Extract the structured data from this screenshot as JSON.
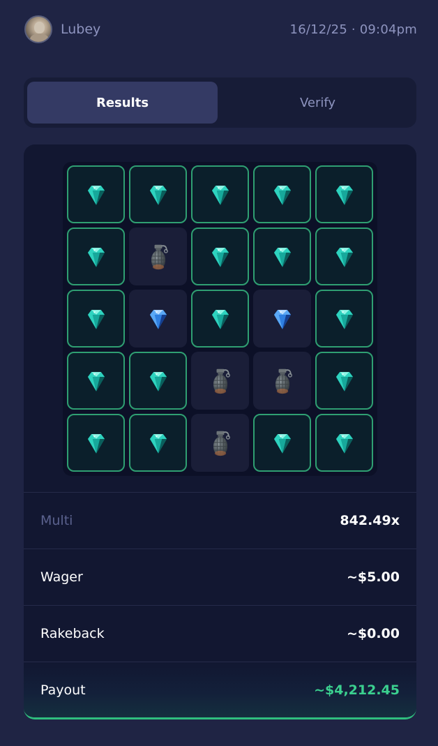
{
  "header": {
    "username": "Lubey",
    "timestamp": "16/12/25 · 09:04pm"
  },
  "tabs": [
    {
      "label": "Results",
      "active": true
    },
    {
      "label": "Verify",
      "active": false
    }
  ],
  "board": {
    "rows": 5,
    "cols": 5,
    "tiles": [
      [
        "gem-revealed",
        "gem-revealed",
        "gem-revealed",
        "gem-revealed",
        "gem-revealed"
      ],
      [
        "gem-revealed",
        "mine",
        "gem-revealed",
        "gem-revealed",
        "gem-revealed"
      ],
      [
        "gem-revealed",
        "gem-unrevealed",
        "gem-revealed",
        "gem-unrevealed",
        "gem-revealed"
      ],
      [
        "gem-revealed",
        "gem-revealed",
        "mine",
        "mine",
        "gem-revealed"
      ],
      [
        "gem-revealed",
        "gem-revealed",
        "mine",
        "gem-revealed",
        "gem-revealed"
      ]
    ]
  },
  "stats": {
    "multi_label": "Multi",
    "multi_value": "842.49x",
    "wager_label": "Wager",
    "wager_value": "~$5.00",
    "rakeback_label": "Rakeback",
    "rakeback_value": "~$0.00",
    "payout_label": "Payout",
    "payout_value": "~$4,212.45"
  },
  "colors": {
    "background": "#1f2444",
    "accent_green": "#3bd08f",
    "revealed_border": "#2f9f72",
    "muted_text": "#8e94bf"
  }
}
